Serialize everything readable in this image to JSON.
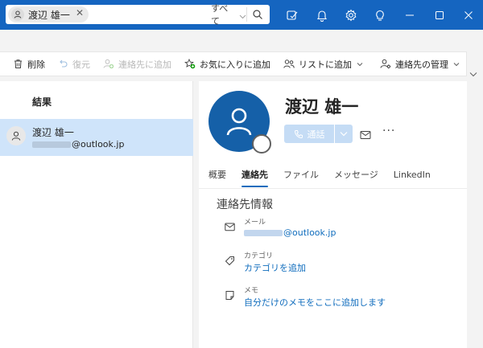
{
  "search": {
    "chip_label": "渡辺 雄一",
    "scope_label": "すべて"
  },
  "ribbon": {
    "delete": "削除",
    "restore": "復元",
    "add_to_contacts": "連絡先に追加",
    "add_to_favorites": "お気に入りに追加",
    "add_to_list": "リストに追加",
    "manage_contacts": "連絡先の管理"
  },
  "results": {
    "title": "結果",
    "items": [
      {
        "name": "渡辺 雄一",
        "email_domain": "@outlook.jp"
      }
    ]
  },
  "contact": {
    "name": "渡辺 雄一",
    "call_label": "通話",
    "tabs": [
      "概要",
      "連絡先",
      "ファイル",
      "メッセージ",
      "LinkedIn"
    ],
    "active_tab": "連絡先",
    "section_title": "連絡先情報",
    "fields": {
      "email_label": "メール",
      "email_domain": "@outlook.jp",
      "category_label": "カテゴリ",
      "category_value": "カテゴリを追加",
      "memo_label": "メモ",
      "memo_value": "自分だけのメモをここに追加します"
    }
  },
  "colors": {
    "titlebar": "#1565c0",
    "accent": "#0f6cbd",
    "selection": "#cfe4fa",
    "avatar": "#1560a8"
  }
}
